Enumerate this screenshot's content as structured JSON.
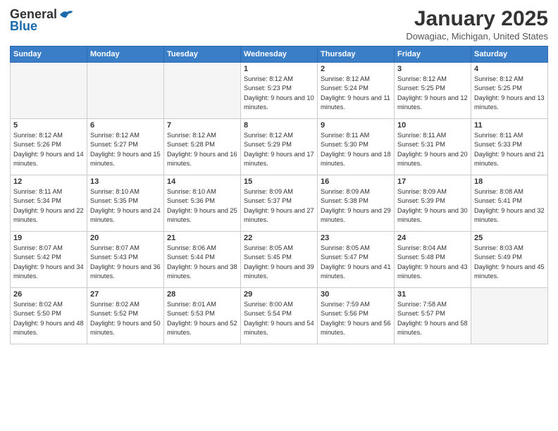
{
  "logo": {
    "general": "General",
    "blue": "Blue"
  },
  "header": {
    "month": "January 2025",
    "location": "Dowagiac, Michigan, United States"
  },
  "weekdays": [
    "Sunday",
    "Monday",
    "Tuesday",
    "Wednesday",
    "Thursday",
    "Friday",
    "Saturday"
  ],
  "weeks": [
    [
      {
        "day": "",
        "empty": true
      },
      {
        "day": "",
        "empty": true
      },
      {
        "day": "",
        "empty": true
      },
      {
        "day": "1",
        "sunrise": "8:12 AM",
        "sunset": "5:23 PM",
        "daylight": "9 hours and 10 minutes."
      },
      {
        "day": "2",
        "sunrise": "8:12 AM",
        "sunset": "5:24 PM",
        "daylight": "9 hours and 11 minutes."
      },
      {
        "day": "3",
        "sunrise": "8:12 AM",
        "sunset": "5:25 PM",
        "daylight": "9 hours and 12 minutes."
      },
      {
        "day": "4",
        "sunrise": "8:12 AM",
        "sunset": "5:25 PM",
        "daylight": "9 hours and 13 minutes."
      }
    ],
    [
      {
        "day": "5",
        "sunrise": "8:12 AM",
        "sunset": "5:26 PM",
        "daylight": "9 hours and 14 minutes."
      },
      {
        "day": "6",
        "sunrise": "8:12 AM",
        "sunset": "5:27 PM",
        "daylight": "9 hours and 15 minutes."
      },
      {
        "day": "7",
        "sunrise": "8:12 AM",
        "sunset": "5:28 PM",
        "daylight": "9 hours and 16 minutes."
      },
      {
        "day": "8",
        "sunrise": "8:12 AM",
        "sunset": "5:29 PM",
        "daylight": "9 hours and 17 minutes."
      },
      {
        "day": "9",
        "sunrise": "8:11 AM",
        "sunset": "5:30 PM",
        "daylight": "9 hours and 18 minutes."
      },
      {
        "day": "10",
        "sunrise": "8:11 AM",
        "sunset": "5:31 PM",
        "daylight": "9 hours and 20 minutes."
      },
      {
        "day": "11",
        "sunrise": "8:11 AM",
        "sunset": "5:33 PM",
        "daylight": "9 hours and 21 minutes."
      }
    ],
    [
      {
        "day": "12",
        "sunrise": "8:11 AM",
        "sunset": "5:34 PM",
        "daylight": "9 hours and 22 minutes."
      },
      {
        "day": "13",
        "sunrise": "8:10 AM",
        "sunset": "5:35 PM",
        "daylight": "9 hours and 24 minutes."
      },
      {
        "day": "14",
        "sunrise": "8:10 AM",
        "sunset": "5:36 PM",
        "daylight": "9 hours and 25 minutes."
      },
      {
        "day": "15",
        "sunrise": "8:09 AM",
        "sunset": "5:37 PM",
        "daylight": "9 hours and 27 minutes."
      },
      {
        "day": "16",
        "sunrise": "8:09 AM",
        "sunset": "5:38 PM",
        "daylight": "9 hours and 29 minutes."
      },
      {
        "day": "17",
        "sunrise": "8:09 AM",
        "sunset": "5:39 PM",
        "daylight": "9 hours and 30 minutes."
      },
      {
        "day": "18",
        "sunrise": "8:08 AM",
        "sunset": "5:41 PM",
        "daylight": "9 hours and 32 minutes."
      }
    ],
    [
      {
        "day": "19",
        "sunrise": "8:07 AM",
        "sunset": "5:42 PM",
        "daylight": "9 hours and 34 minutes."
      },
      {
        "day": "20",
        "sunrise": "8:07 AM",
        "sunset": "5:43 PM",
        "daylight": "9 hours and 36 minutes."
      },
      {
        "day": "21",
        "sunrise": "8:06 AM",
        "sunset": "5:44 PM",
        "daylight": "9 hours and 38 minutes."
      },
      {
        "day": "22",
        "sunrise": "8:05 AM",
        "sunset": "5:45 PM",
        "daylight": "9 hours and 39 minutes."
      },
      {
        "day": "23",
        "sunrise": "8:05 AM",
        "sunset": "5:47 PM",
        "daylight": "9 hours and 41 minutes."
      },
      {
        "day": "24",
        "sunrise": "8:04 AM",
        "sunset": "5:48 PM",
        "daylight": "9 hours and 43 minutes."
      },
      {
        "day": "25",
        "sunrise": "8:03 AM",
        "sunset": "5:49 PM",
        "daylight": "9 hours and 45 minutes."
      }
    ],
    [
      {
        "day": "26",
        "sunrise": "8:02 AM",
        "sunset": "5:50 PM",
        "daylight": "9 hours and 48 minutes."
      },
      {
        "day": "27",
        "sunrise": "8:02 AM",
        "sunset": "5:52 PM",
        "daylight": "9 hours and 50 minutes."
      },
      {
        "day": "28",
        "sunrise": "8:01 AM",
        "sunset": "5:53 PM",
        "daylight": "9 hours and 52 minutes."
      },
      {
        "day": "29",
        "sunrise": "8:00 AM",
        "sunset": "5:54 PM",
        "daylight": "9 hours and 54 minutes."
      },
      {
        "day": "30",
        "sunrise": "7:59 AM",
        "sunset": "5:56 PM",
        "daylight": "9 hours and 56 minutes."
      },
      {
        "day": "31",
        "sunrise": "7:58 AM",
        "sunset": "5:57 PM",
        "daylight": "9 hours and 58 minutes."
      },
      {
        "day": "",
        "empty": true
      }
    ]
  ]
}
